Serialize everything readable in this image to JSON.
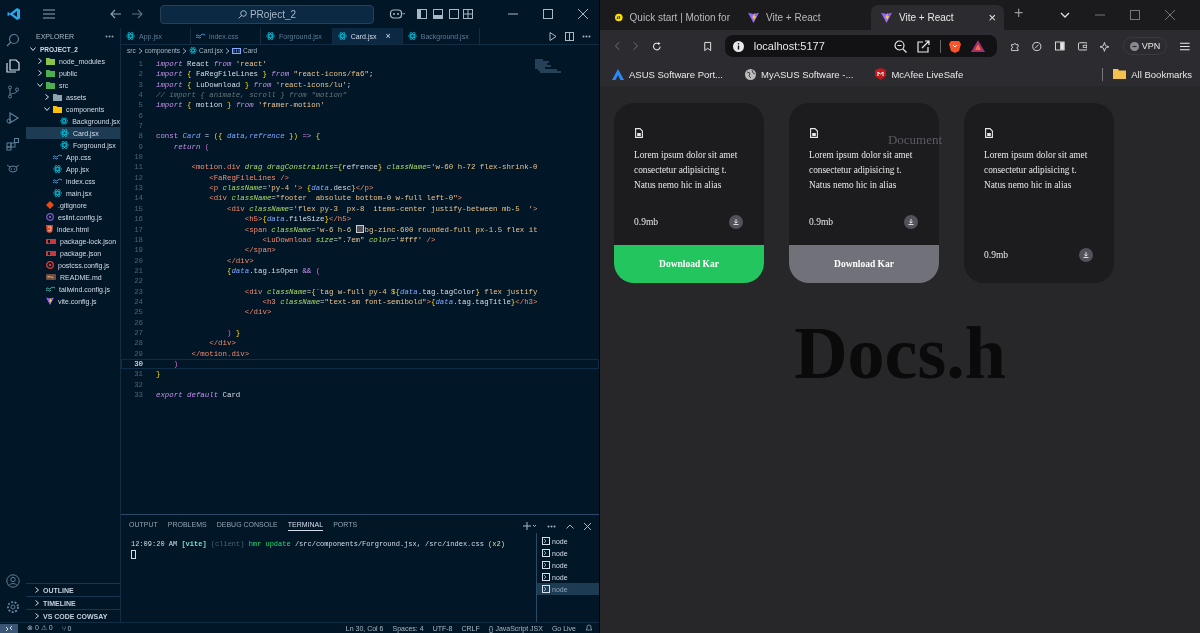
{
  "vscode": {
    "command_center": "PRoject_2",
    "explorer": {
      "title": "EXPLORER",
      "root": "PROJECT_2",
      "tree": [
        {
          "label": "node_modules",
          "kind": "folder",
          "color": "#8bc34a",
          "expanded": false,
          "selected": false
        },
        {
          "label": "public",
          "kind": "folder",
          "color": "#4caf50",
          "expanded": false,
          "selected": false
        },
        {
          "label": "src",
          "kind": "folder",
          "color": "#4caf50",
          "expanded": true,
          "selected": false,
          "children": [
            {
              "label": "assets",
              "kind": "folder",
              "color": "#90a4ae",
              "expanded": false,
              "selected": false
            },
            {
              "label": "components",
              "kind": "folder",
              "color": "#ffc107",
              "expanded": true,
              "selected": false,
              "children": [
                {
                  "label": "Background.jsx",
                  "kind": "react",
                  "selected": false
                },
                {
                  "label": "Card.jsx",
                  "kind": "react",
                  "selected": true
                },
                {
                  "label": "Forground.jsx",
                  "kind": "react",
                  "selected": false
                }
              ]
            },
            {
              "label": "App.css",
              "kind": "css",
              "selected": false
            },
            {
              "label": "App.jsx",
              "kind": "react",
              "selected": false
            },
            {
              "label": "index.css",
              "kind": "css",
              "selected": false
            },
            {
              "label": "main.jsx",
              "kind": "react",
              "selected": false
            }
          ]
        },
        {
          "label": ".gitignore",
          "kind": "git",
          "selected": false
        },
        {
          "label": "eslint.config.js",
          "kind": "eslint",
          "selected": false
        },
        {
          "label": "index.html",
          "kind": "html",
          "selected": false
        },
        {
          "label": "package-lock.json",
          "kind": "npm",
          "selected": false
        },
        {
          "label": "package.json",
          "kind": "npm",
          "selected": false
        },
        {
          "label": "postcss.config.js",
          "kind": "postcss",
          "selected": false
        },
        {
          "label": "README.md",
          "kind": "readme",
          "selected": false
        },
        {
          "label": "tailwind.config.js",
          "kind": "tailwind",
          "selected": false
        },
        {
          "label": "vite.config.js",
          "kind": "vite",
          "selected": false
        }
      ],
      "sections": [
        "OUTLINE",
        "TIMELINE",
        "VS CODE COWSAY"
      ]
    },
    "tabs": [
      {
        "label": "App.jsx",
        "kind": "react",
        "selected": false
      },
      {
        "label": "index.css",
        "kind": "css",
        "selected": false
      },
      {
        "label": "Forground.jsx",
        "kind": "react",
        "selected": false
      },
      {
        "label": "Card.jsx",
        "kind": "react",
        "selected": true
      },
      {
        "label": "Background.jsx",
        "kind": "react",
        "selected": false
      }
    ],
    "close_glyph": "×",
    "breadcrumbs": [
      "src",
      "components",
      "Card.jsx",
      "Card"
    ],
    "code": [
      {
        "number": "1",
        "current": false,
        "tokens": [
          {
            "kind": "kw",
            "text": "import"
          },
          {
            "kind": "plain",
            "text": " React "
          },
          {
            "kind": "kw",
            "text": "from"
          },
          {
            "kind": "str",
            "text": " 'react'"
          }
        ]
      },
      {
        "number": "2",
        "current": false,
        "tokens": [
          {
            "kind": "kw",
            "text": "import"
          },
          {
            "kind": "brace",
            "text": " { "
          },
          {
            "kind": "plain",
            "text": "FaRegFileLines"
          },
          {
            "kind": "brace",
            "text": " } "
          },
          {
            "kind": "kw",
            "text": "from"
          },
          {
            "kind": "str",
            "text": " \"react-icons/fa6\""
          },
          {
            "kind": "plain",
            "text": ";"
          }
        ]
      },
      {
        "number": "3",
        "current": false,
        "tokens": [
          {
            "kind": "kw",
            "text": "import"
          },
          {
            "kind": "brace",
            "text": " { "
          },
          {
            "kind": "plain",
            "text": "LuDownload"
          },
          {
            "kind": "brace",
            "text": " } "
          },
          {
            "kind": "kw",
            "text": "from"
          },
          {
            "kind": "str",
            "text": " 'react-icons/lu'"
          },
          {
            "kind": "plain",
            "text": ";"
          }
        ]
      },
      {
        "number": "4",
        "current": false,
        "tokens": [
          {
            "kind": "comment",
            "text": "// import { animate, scroll } from \"motion\""
          }
        ]
      },
      {
        "number": "5",
        "current": false,
        "tokens": [
          {
            "kind": "kw",
            "text": "import"
          },
          {
            "kind": "brace",
            "text": " { "
          },
          {
            "kind": "plain",
            "text": "motion"
          },
          {
            "kind": "brace",
            "text": " } "
          },
          {
            "kind": "kw",
            "text": "from"
          },
          {
            "kind": "str",
            "text": " 'framer-motion'"
          }
        ]
      },
      {
        "number": "6",
        "current": false
      },
      {
        "number": "7",
        "current": false
      },
      {
        "number": "8",
        "current": false,
        "tokens": [
          {
            "kind": "kw2",
            "text": "const"
          },
          {
            "kind": "var",
            "text": " Card"
          },
          {
            "kind": "plain",
            "text": " = "
          },
          {
            "kind": "brace",
            "text": "({ "
          },
          {
            "kind": "var",
            "text": "data,refrence"
          },
          {
            "kind": "brace",
            "text": " })"
          },
          {
            "kind": "kw2",
            "text": " => "
          },
          {
            "kind": "brace",
            "text": "{"
          }
        ]
      },
      {
        "number": "9",
        "current": false,
        "tokens": [
          {
            "kind": "kw",
            "text": "    return"
          },
          {
            "kind": "punct",
            "text": " ("
          }
        ]
      },
      {
        "number": "10",
        "current": false
      },
      {
        "number": "11",
        "current": false,
        "tokens": [
          {
            "kind": "tag",
            "text": "        <motion.div"
          },
          {
            "kind": "attr",
            "text": " drag dragConstraints"
          },
          {
            "kind": "plain",
            "text": "="
          },
          {
            "kind": "brace",
            "text": "{"
          },
          {
            "kind": "plain",
            "text": "refrence"
          },
          {
            "kind": "brace",
            "text": "}"
          },
          {
            "kind": "attr",
            "text": " className"
          },
          {
            "kind": "plain",
            "text": "="
          },
          {
            "kind": "str",
            "text": "'w-60 h-72 flex-shrink-0"
          }
        ]
      },
      {
        "number": "12",
        "current": false,
        "tokens": [
          {
            "kind": "tag",
            "text": "            <FaRegFileLines />"
          }
        ]
      },
      {
        "number": "13",
        "current": false,
        "tokens": [
          {
            "kind": "tag",
            "text": "            <p"
          },
          {
            "kind": "attr",
            "text": " className"
          },
          {
            "kind": "plain",
            "text": "="
          },
          {
            "kind": "str",
            "text": "'py-4 '"
          },
          {
            "kind": "tag",
            "text": ">"
          },
          {
            "kind": "brace",
            "text": " {"
          },
          {
            "kind": "var",
            "text": "data"
          },
          {
            "kind": "plain",
            "text": ".desc"
          },
          {
            "kind": "brace",
            "text": "}"
          },
          {
            "kind": "tag",
            "text": "</p>"
          }
        ]
      },
      {
        "number": "14",
        "current": false,
        "tokens": [
          {
            "kind": "tag",
            "text": "            <div"
          },
          {
            "kind": "attr",
            "text": " className"
          },
          {
            "kind": "plain",
            "text": "="
          },
          {
            "kind": "str",
            "text": "\"footer  absolute bottom-0 w-full left-0\""
          },
          {
            "kind": "tag",
            "text": ">"
          }
        ]
      },
      {
        "number": "15",
        "current": false,
        "tokens": [
          {
            "kind": "tag",
            "text": "                <div"
          },
          {
            "kind": "attr",
            "text": " className"
          },
          {
            "kind": "plain",
            "text": "="
          },
          {
            "kind": "str",
            "text": "'flex py-3  px-8  items-center justify-between mb-5  '"
          },
          {
            "kind": "tag",
            "text": ">"
          }
        ]
      },
      {
        "number": "16",
        "current": false,
        "tokens": [
          {
            "kind": "tag",
            "text": "                    <h5>"
          },
          {
            "kind": "brace",
            "text": "{"
          },
          {
            "kind": "var",
            "text": "data"
          },
          {
            "kind": "plain",
            "text": ".fileSize"
          },
          {
            "kind": "brace",
            "text": "}"
          },
          {
            "kind": "tag",
            "text": "</h5>"
          }
        ]
      },
      {
        "number": "17",
        "current": false,
        "tokens": [
          {
            "kind": "tag",
            "text": "                    <span"
          },
          {
            "kind": "attr",
            "text": " className"
          },
          {
            "kind": "plain",
            "text": "="
          },
          {
            "kind": "str",
            "text": "'w-6 h-6 "
          },
          {
            "kind": "swatch"
          },
          {
            "kind": "str",
            "text": "bg-zinc-600 rounded-full px-1.5 flex it"
          }
        ]
      },
      {
        "number": "18",
        "current": false,
        "tokens": [
          {
            "kind": "tag",
            "text": "                        <LuDownload"
          },
          {
            "kind": "attr",
            "text": " size"
          },
          {
            "kind": "plain",
            "text": "="
          },
          {
            "kind": "str",
            "text": "\".7em\""
          },
          {
            "kind": "attr",
            "text": " color"
          },
          {
            "kind": "plain",
            "text": "="
          },
          {
            "kind": "str",
            "text": "'#fff'"
          },
          {
            "kind": "tag",
            "text": " />"
          }
        ]
      },
      {
        "number": "19",
        "current": false,
        "tokens": [
          {
            "kind": "tag",
            "text": "                    </span>"
          }
        ]
      },
      {
        "number": "20",
        "current": false,
        "tokens": [
          {
            "kind": "tag",
            "text": "                </div>"
          }
        ]
      },
      {
        "number": "21",
        "current": false,
        "tokens": [
          {
            "kind": "brace",
            "text": "                {"
          },
          {
            "kind": "var",
            "text": "data"
          },
          {
            "kind": "plain",
            "text": ".tag.isOpen "
          },
          {
            "kind": "kw2",
            "text": "&&"
          },
          {
            "kind": "punct",
            "text": " ("
          }
        ]
      },
      {
        "number": "22",
        "current": false
      },
      {
        "number": "23",
        "current": false,
        "tokens": [
          {
            "kind": "tag",
            "text": "                    <div"
          },
          {
            "kind": "attr",
            "text": " className"
          },
          {
            "kind": "plain",
            "text": "="
          },
          {
            "kind": "brace",
            "text": "{"
          },
          {
            "kind": "str",
            "text": "`tag w-full py-4 "
          },
          {
            "kind": "brace",
            "text": "${"
          },
          {
            "kind": "var",
            "text": "data"
          },
          {
            "kind": "plain",
            "text": ".tag.tagColor"
          },
          {
            "kind": "brace",
            "text": "}"
          },
          {
            "kind": "str",
            "text": " flex justify"
          }
        ]
      },
      {
        "number": "24",
        "current": false,
        "tokens": [
          {
            "kind": "tag",
            "text": "                        <h3"
          },
          {
            "kind": "attr",
            "text": " className"
          },
          {
            "kind": "plain",
            "text": "="
          },
          {
            "kind": "str",
            "text": "\"text-sm font-semibold\""
          },
          {
            "kind": "tag",
            "text": ">"
          },
          {
            "kind": "brace",
            "text": "{"
          },
          {
            "kind": "var",
            "text": "data"
          },
          {
            "kind": "plain",
            "text": ".tag.tagTitle"
          },
          {
            "kind": "brace",
            "text": "}"
          },
          {
            "kind": "tag",
            "text": "</h3>"
          }
        ]
      },
      {
        "number": "25",
        "current": false,
        "tokens": [
          {
            "kind": "tag",
            "text": "                    </div>"
          }
        ]
      },
      {
        "number": "26",
        "current": false
      },
      {
        "number": "27",
        "current": false,
        "tokens": [
          {
            "kind": "punct",
            "text": "                ) "
          },
          {
            "kind": "brace",
            "text": "}"
          }
        ]
      },
      {
        "number": "28",
        "current": false,
        "tokens": [
          {
            "kind": "tag",
            "text": "            </div>"
          }
        ]
      },
      {
        "number": "29",
        "current": false,
        "tokens": [
          {
            "kind": "tag",
            "text": "        </motion.div>"
          }
        ]
      },
      {
        "number": "30",
        "current": true,
        "tokens": [
          {
            "kind": "punct",
            "text": "    )"
          }
        ]
      },
      {
        "number": "31",
        "current": false,
        "tokens": [
          {
            "kind": "brace",
            "text": "}"
          }
        ]
      },
      {
        "number": "32",
        "current": false
      },
      {
        "number": "33",
        "current": false,
        "tokens": [
          {
            "kind": "kw",
            "text": "export default"
          },
          {
            "kind": "plain",
            "text": " Card"
          }
        ]
      }
    ],
    "panel_tabs": [
      {
        "label": "OUTPUT",
        "selected": false
      },
      {
        "label": "PROBLEMS",
        "selected": false
      },
      {
        "label": "DEBUG CONSOLE",
        "selected": false
      },
      {
        "label": "TERMINAL",
        "selected": true
      },
      {
        "label": "PORTS",
        "selected": false
      }
    ],
    "terminal": [
      {
        "kind": "time",
        "text": "12:09:20 AM "
      },
      {
        "kind": "vite",
        "text": "[vite]"
      },
      {
        "kind": "dim",
        "text": " (client) "
      },
      {
        "kind": "cmd",
        "text": "hmr update "
      },
      {
        "kind": "path",
        "text": "/src/components/Forground.jsx, /src/index.css "
      },
      {
        "kind": "count",
        "text": "(x2)"
      }
    ],
    "terminals": [
      {
        "label": "node",
        "selected": false
      },
      {
        "label": "node",
        "selected": false
      },
      {
        "label": "node",
        "selected": false
      },
      {
        "label": "node",
        "selected": false
      },
      {
        "label": "node",
        "selected": true
      }
    ],
    "status_left": [
      "⊗ 0 ⚠ 0",
      "⑂ 0"
    ],
    "status_right": [
      "Ln 30, Col 6",
      "Spaces: 4",
      "UTF-8",
      "CRLF",
      "{} JavaScript JSX",
      "Go Live"
    ]
  },
  "browser": {
    "tabs": [
      {
        "label": "Quick start | Motion for",
        "kind": "motion",
        "selected": false
      },
      {
        "label": "Vite + React",
        "kind": "vite",
        "selected": false
      },
      {
        "label": "Vite + React",
        "kind": "vite",
        "selected": true
      }
    ],
    "new_tab": "+",
    "close_glyph": "×",
    "url": "localhost:5177",
    "vpn": "VPN",
    "bookmarks": [
      {
        "label": "ASUS Software Port...",
        "kind": "asus"
      },
      {
        "label": "MyASUS Software -...",
        "kind": "globe"
      },
      {
        "label": "McAfee LiveSafe",
        "kind": "mcafee"
      }
    ],
    "all_bookmarks": "All Bookmarks",
    "background_label": "Document",
    "background_title": "Docs.h",
    "cards": [
      {
        "desc": "Lorem ipsum dolor sit amet consectetur adipisicing t. Natus nemo hic in alias",
        "size": "0.9mb",
        "tag": {
          "title": "Download Kar",
          "color": "#22c55e"
        }
      },
      {
        "desc": "Lorem ipsum dolor sit amet consectetur adipisicing t. Natus nemo hic in alias",
        "size": "0.9mb",
        "tag": {
          "title": "Download Kar",
          "color": "#71717a"
        }
      },
      {
        "desc": "Lorem ipsum dolor sit amet consectetur adipisicing t. Natus nemo hic in alias",
        "size": "0.9mb"
      }
    ]
  }
}
